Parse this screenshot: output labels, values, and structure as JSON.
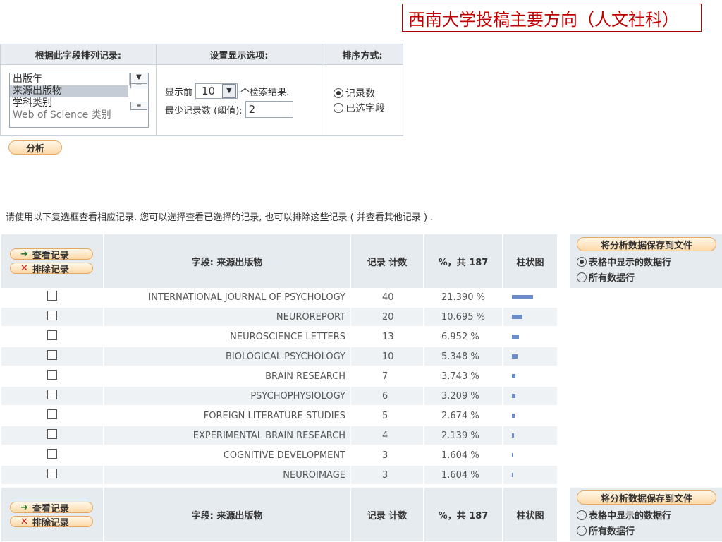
{
  "title": "西南大学投稿主要方向（人文社科）",
  "options": {
    "sort_field_header": "根据此字段排列记录:",
    "display_header": "设置显示选项:",
    "order_header": "排序方式:",
    "fields": [
      "出版年",
      "来源出版物",
      "学科类别",
      "Web of Science 类别"
    ],
    "selected_field": "来源出版物",
    "show_top_prefix": "显示前",
    "show_top_value": "10",
    "show_top_suffix": "个检索结果.",
    "min_records_label": "最少记录数 (阈值):",
    "min_records_value": "2",
    "order_options": [
      "记录数",
      "已选字段"
    ],
    "order_selected": "记录数",
    "analyze_button": "分析"
  },
  "note": "请使用以下复选框查看相应记录. 您可以选择查看已选择的记录, 也可以排除这些记录 ( 并查看其他记录 ) .",
  "header": {
    "view_button": "查看记录",
    "exclude_button": "排除记录",
    "field_col": "字段: 来源出版物",
    "count_col": "记录 计数",
    "percent_col": "%，共 187",
    "bar_col": "柱状图",
    "save_button": "将分析数据保存到文件",
    "save_opts": [
      "表格中显示的数据行",
      "所有数据行"
    ]
  },
  "rows": [
    {
      "name": "INTERNATIONAL JOURNAL OF PSYCHOLOGY",
      "count": "40",
      "pct": "21.390 %",
      "bar": 40
    },
    {
      "name": "NEUROREPORT",
      "count": "20",
      "pct": "10.695 %",
      "bar": 20
    },
    {
      "name": "NEUROSCIENCE LETTERS",
      "count": "13",
      "pct": "6.952 %",
      "bar": 13
    },
    {
      "name": "BIOLOGICAL PSYCHOLOGY",
      "count": "10",
      "pct": "5.348 %",
      "bar": 10
    },
    {
      "name": "BRAIN RESEARCH",
      "count": "7",
      "pct": "3.743 %",
      "bar": 7
    },
    {
      "name": "PSYCHOPHYSIOLOGY",
      "count": "6",
      "pct": "3.209 %",
      "bar": 6
    },
    {
      "name": "FOREIGN LITERATURE STUDIES",
      "count": "5",
      "pct": "2.674 %",
      "bar": 5
    },
    {
      "name": "EXPERIMENTAL BRAIN RESEARCH",
      "count": "4",
      "pct": "2.139 %",
      "bar": 4
    },
    {
      "name": "COGNITIVE DEVELOPMENT",
      "count": "3",
      "pct": "1.604 %",
      "bar": 3
    },
    {
      "name": "NEUROIMAGE",
      "count": "3",
      "pct": "1.604 %",
      "bar": 3
    }
  ],
  "colors": {
    "title_border": "#b00000",
    "title_text": "#c00000",
    "bar": "#6b8cc8",
    "header_bg": "#e6ebef",
    "button": "#fcd9a8"
  }
}
